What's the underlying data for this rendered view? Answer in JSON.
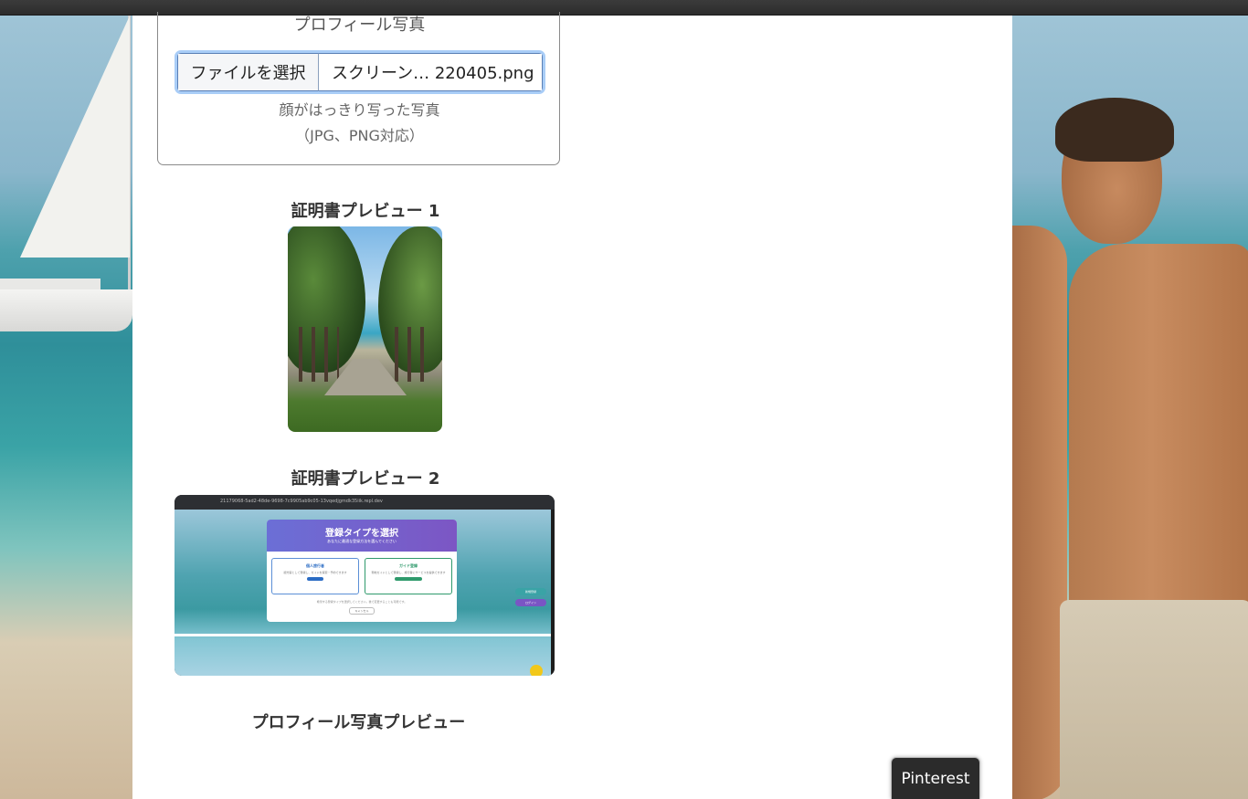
{
  "upload": {
    "label": "プロフィール写真",
    "file_button": "ファイルを選択",
    "file_name": "スクリーン… 220405.png",
    "hint_line1": "顔がはっきり写った写真",
    "hint_line2": "（JPG、PNG対応）"
  },
  "previews": {
    "cert1_title": "証明書プレビュー 1",
    "cert2_title": "証明書プレビュー 2",
    "profile_title": "プロフィール写真プレビュー"
  },
  "cert2_screenshot": {
    "url": "21179068-5ad2-48de-9698-7c9905ab9c05-13vqedjgmdk35iik.repl.dev",
    "modal_title": "登録タイプを選択",
    "modal_subtitle": "あなたに最適な登録方法を選んでください",
    "option1_title": "個人旅行者",
    "option1_desc": "観光客として登録し、ガイドを探索・予約できます",
    "option1_button": "旅行者登録",
    "option2_title": "ガイド登録",
    "option2_desc": "現地ガイドとして登録し、旅行者にサービスを提供できます",
    "option2_button": "ガイドとして登録する",
    "footer_text": "希望する登録タイプを選択してください。後で変更することも可能です。",
    "cancel_button": "キャンセル",
    "pill1": "新規登録",
    "pill2": "ログイン"
  },
  "pinterest_button": "Pinterest"
}
